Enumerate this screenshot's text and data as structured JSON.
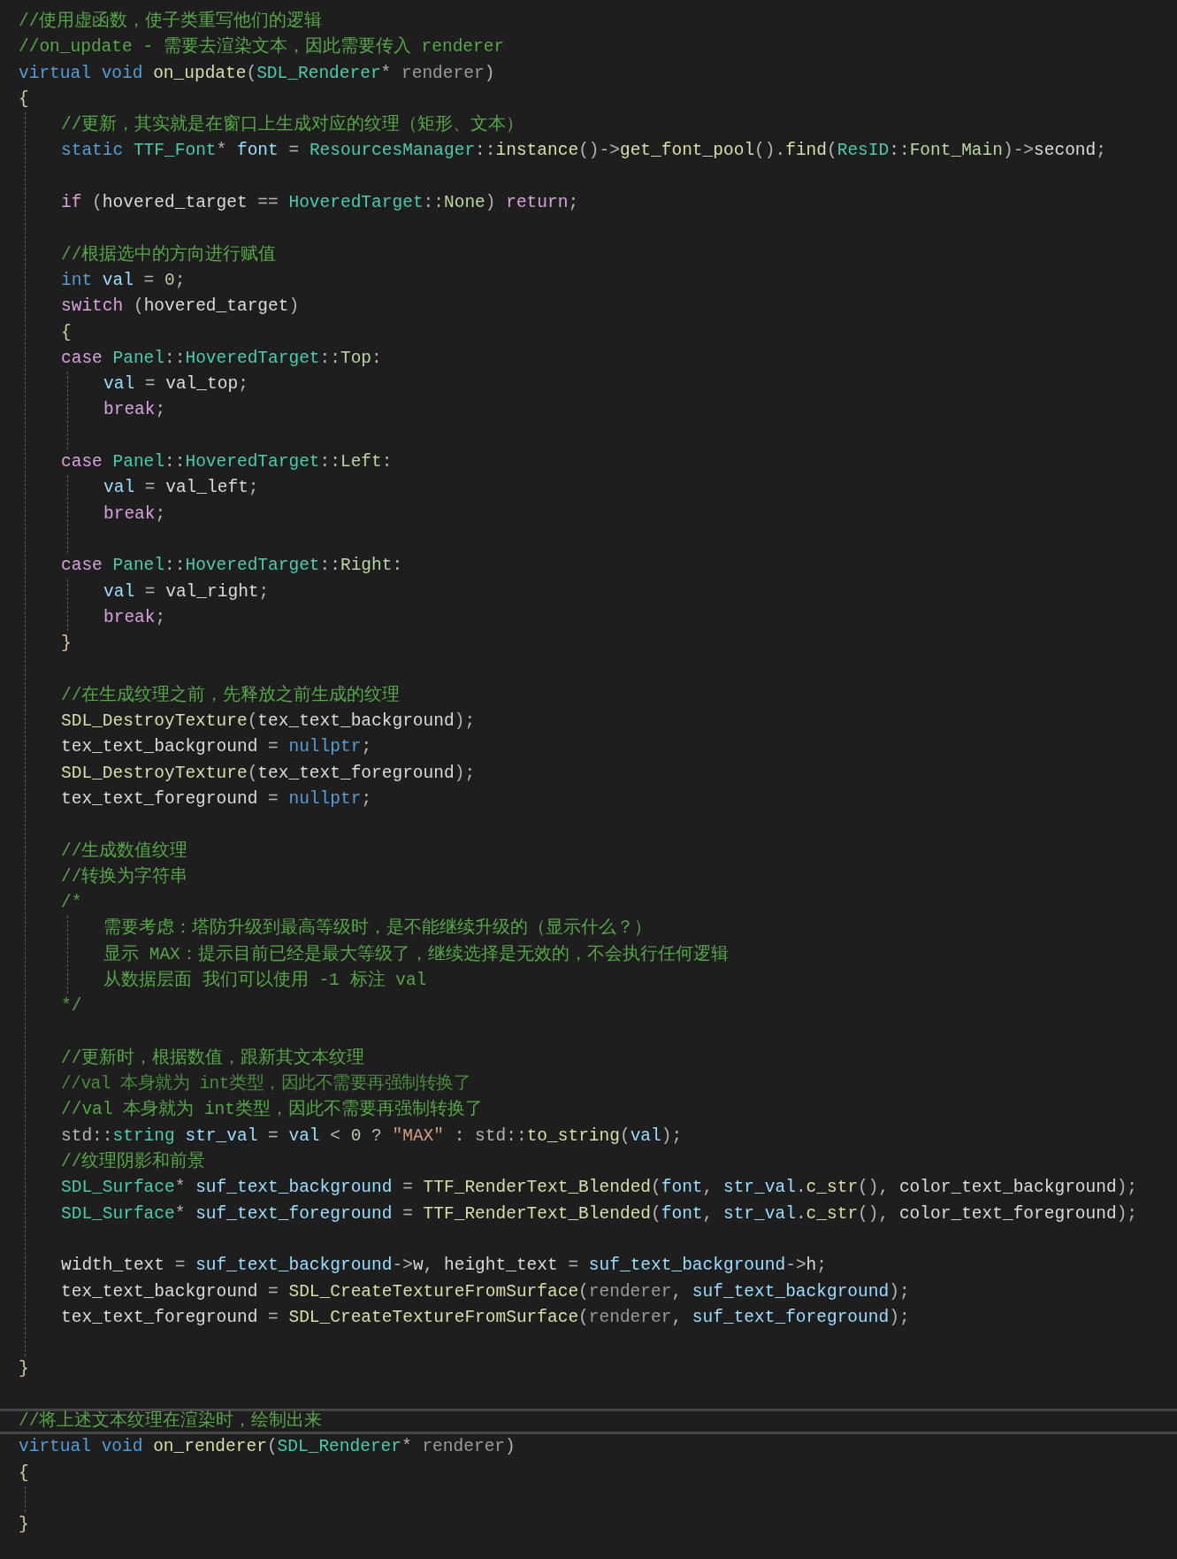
{
  "editor": {
    "lines": [
      {
        "kind": "code",
        "tokens": [
          {
            "text": "//使用虚函数，使子类重写他们的逻辑",
            "kind": "comment"
          }
        ]
      },
      {
        "kind": "code",
        "tokens": [
          {
            "text": "//on_update - 需要去渲染文本，因此需要传入 renderer",
            "kind": "comment"
          }
        ]
      },
      {
        "kind": "code",
        "tokens": [
          {
            "text": "virtual ",
            "kind": "keyword"
          },
          {
            "text": "void ",
            "kind": "keyword"
          },
          {
            "text": "on_update",
            "kind": "function"
          },
          {
            "text": "(",
            "kind": "punct"
          },
          {
            "text": "SDL_Renderer",
            "kind": "type"
          },
          {
            "text": "* ",
            "kind": "punct"
          },
          {
            "text": "renderer",
            "kind": "param"
          },
          {
            "text": ")",
            "kind": "punct"
          }
        ]
      },
      {
        "kind": "code",
        "tokens": [
          {
            "text": "{",
            "kind": "brace"
          }
        ],
        "children": [
          {
            "kind": "code",
            "tokens": [
              {
                "text": "//更新，其实就是在窗口上生成对应的纹理（矩形、文本）",
                "kind": "comment"
              }
            ]
          },
          {
            "kind": "code",
            "tokens": [
              {
                "text": "static ",
                "kind": "keyword"
              },
              {
                "text": "TTF_Font",
                "kind": "type"
              },
              {
                "text": "* ",
                "kind": "punct"
              },
              {
                "text": "font",
                "kind": "local"
              },
              {
                "text": " = ",
                "kind": "punct"
              },
              {
                "text": "ResourcesManager",
                "kind": "type"
              },
              {
                "text": "::",
                "kind": "punct"
              },
              {
                "text": "instance",
                "kind": "function"
              },
              {
                "text": "()->",
                "kind": "punct"
              },
              {
                "text": "get_font_pool",
                "kind": "function"
              },
              {
                "text": "().",
                "kind": "punct"
              },
              {
                "text": "find",
                "kind": "function"
              },
              {
                "text": "(",
                "kind": "punct"
              },
              {
                "text": "ResID",
                "kind": "type"
              },
              {
                "text": "::",
                "kind": "punct"
              },
              {
                "text": "Font_Main",
                "kind": "enum"
              },
              {
                "text": ")->",
                "kind": "punct"
              },
              {
                "text": "second",
                "kind": "member"
              },
              {
                "text": ";",
                "kind": "punct"
              }
            ]
          },
          {
            "kind": "blank"
          },
          {
            "kind": "code",
            "tokens": [
              {
                "text": "if",
                "kind": "control"
              },
              {
                "text": " (",
                "kind": "punct"
              },
              {
                "text": "hovered_target",
                "kind": "member"
              },
              {
                "text": " == ",
                "kind": "punct"
              },
              {
                "text": "HoveredTarget",
                "kind": "type"
              },
              {
                "text": "::",
                "kind": "punct"
              },
              {
                "text": "None",
                "kind": "enum"
              },
              {
                "text": ") ",
                "kind": "punct"
              },
              {
                "text": "return",
                "kind": "control"
              },
              {
                "text": ";",
                "kind": "punct"
              }
            ]
          },
          {
            "kind": "blank"
          },
          {
            "kind": "code",
            "tokens": [
              {
                "text": "//根据选中的方向进行赋值",
                "kind": "comment"
              }
            ]
          },
          {
            "kind": "code",
            "tokens": [
              {
                "text": "int ",
                "kind": "keyword"
              },
              {
                "text": "val",
                "kind": "local"
              },
              {
                "text": " = ",
                "kind": "punct"
              },
              {
                "text": "0",
                "kind": "number"
              },
              {
                "text": ";",
                "kind": "punct"
              }
            ]
          },
          {
            "kind": "code",
            "tokens": [
              {
                "text": "switch",
                "kind": "control"
              },
              {
                "text": " (",
                "kind": "punct"
              },
              {
                "text": "hovered_target",
                "kind": "member"
              },
              {
                "text": ")",
                "kind": "punct"
              }
            ]
          },
          {
            "kind": "code",
            "tokens": [
              {
                "text": "{",
                "kind": "brace"
              }
            ]
          },
          {
            "kind": "code",
            "tokens": [
              {
                "text": "case ",
                "kind": "control"
              },
              {
                "text": "Panel",
                "kind": "type"
              },
              {
                "text": "::",
                "kind": "punct"
              },
              {
                "text": "HoveredTarget",
                "kind": "type"
              },
              {
                "text": "::",
                "kind": "punct"
              },
              {
                "text": "Top",
                "kind": "enum"
              },
              {
                "text": ":",
                "kind": "punct"
              }
            ],
            "children": [
              {
                "kind": "code",
                "tokens": [
                  {
                    "text": "val",
                    "kind": "local"
                  },
                  {
                    "text": " = ",
                    "kind": "punct"
                  },
                  {
                    "text": "val_top",
                    "kind": "member"
                  },
                  {
                    "text": ";",
                    "kind": "punct"
                  }
                ]
              },
              {
                "kind": "code",
                "tokens": [
                  {
                    "text": "break",
                    "kind": "control"
                  },
                  {
                    "text": ";",
                    "kind": "punct"
                  }
                ]
              },
              {
                "kind": "blank"
              }
            ]
          },
          {
            "kind": "code",
            "tokens": [
              {
                "text": "case ",
                "kind": "control"
              },
              {
                "text": "Panel",
                "kind": "type"
              },
              {
                "text": "::",
                "kind": "punct"
              },
              {
                "text": "HoveredTarget",
                "kind": "type"
              },
              {
                "text": "::",
                "kind": "punct"
              },
              {
                "text": "Left",
                "kind": "enum"
              },
              {
                "text": ":",
                "kind": "punct"
              }
            ],
            "children": [
              {
                "kind": "code",
                "tokens": [
                  {
                    "text": "val",
                    "kind": "local"
                  },
                  {
                    "text": " = ",
                    "kind": "punct"
                  },
                  {
                    "text": "val_left",
                    "kind": "member"
                  },
                  {
                    "text": ";",
                    "kind": "punct"
                  }
                ]
              },
              {
                "kind": "code",
                "tokens": [
                  {
                    "text": "break",
                    "kind": "control"
                  },
                  {
                    "text": ";",
                    "kind": "punct"
                  }
                ]
              },
              {
                "kind": "blank"
              }
            ]
          },
          {
            "kind": "code",
            "tokens": [
              {
                "text": "case ",
                "kind": "control"
              },
              {
                "text": "Panel",
                "kind": "type"
              },
              {
                "text": "::",
                "kind": "punct"
              },
              {
                "text": "HoveredTarget",
                "kind": "type"
              },
              {
                "text": "::",
                "kind": "punct"
              },
              {
                "text": "Right",
                "kind": "enum"
              },
              {
                "text": ":",
                "kind": "punct"
              }
            ],
            "children": [
              {
                "kind": "code",
                "tokens": [
                  {
                    "text": "val",
                    "kind": "local"
                  },
                  {
                    "text": " = ",
                    "kind": "punct"
                  },
                  {
                    "text": "val_right",
                    "kind": "member"
                  },
                  {
                    "text": ";",
                    "kind": "punct"
                  }
                ]
              },
              {
                "kind": "code",
                "tokens": [
                  {
                    "text": "break",
                    "kind": "control"
                  },
                  {
                    "text": ";",
                    "kind": "punct"
                  }
                ]
              }
            ]
          },
          {
            "kind": "code",
            "tokens": [
              {
                "text": "}",
                "kind": "brace"
              }
            ]
          },
          {
            "kind": "blank"
          },
          {
            "kind": "code",
            "tokens": [
              {
                "text": "//在生成纹理之前，先释放之前生成的纹理",
                "kind": "comment"
              }
            ]
          },
          {
            "kind": "code",
            "tokens": [
              {
                "text": "SDL_DestroyTexture",
                "kind": "function"
              },
              {
                "text": "(",
                "kind": "punct"
              },
              {
                "text": "tex_text_background",
                "kind": "member"
              },
              {
                "text": ");",
                "kind": "punct"
              }
            ]
          },
          {
            "kind": "code",
            "tokens": [
              {
                "text": "tex_text_background",
                "kind": "member"
              },
              {
                "text": " = ",
                "kind": "punct"
              },
              {
                "text": "nullptr",
                "kind": "keyword"
              },
              {
                "text": ";",
                "kind": "punct"
              }
            ]
          },
          {
            "kind": "code",
            "tokens": [
              {
                "text": "SDL_DestroyTexture",
                "kind": "function"
              },
              {
                "text": "(",
                "kind": "punct"
              },
              {
                "text": "tex_text_foreground",
                "kind": "member"
              },
              {
                "text": ");",
                "kind": "punct"
              }
            ]
          },
          {
            "kind": "code",
            "tokens": [
              {
                "text": "tex_text_foreground",
                "kind": "member"
              },
              {
                "text": " = ",
                "kind": "punct"
              },
              {
                "text": "nullptr",
                "kind": "keyword"
              },
              {
                "text": ";",
                "kind": "punct"
              }
            ]
          },
          {
            "kind": "blank"
          },
          {
            "kind": "code",
            "tokens": [
              {
                "text": "//生成数值纹理",
                "kind": "comment"
              }
            ]
          },
          {
            "kind": "code",
            "tokens": [
              {
                "text": "//转换为字符串",
                "kind": "comment"
              }
            ]
          },
          {
            "kind": "code",
            "tokens": [
              {
                "text": "/*",
                "kind": "comment"
              }
            ],
            "children": [
              {
                "kind": "code",
                "tokens": [
                  {
                    "text": "需要考虑：塔防升级到最高等级时，是不能继续升级的（显示什么？）",
                    "kind": "comment"
                  }
                ]
              },
              {
                "kind": "code",
                "tokens": [
                  {
                    "text": "显示 MAX：提示目前已经是最大等级了，继续选择是无效的，不会执行任何逻辑",
                    "kind": "comment"
                  }
                ]
              },
              {
                "kind": "code",
                "tokens": [
                  {
                    "text": "从数据层面 我们可以使用 -1 标注 val",
                    "kind": "comment"
                  }
                ]
              }
            ]
          },
          {
            "kind": "code",
            "tokens": [
              {
                "text": "*/",
                "kind": "comment"
              }
            ]
          },
          {
            "kind": "blank"
          },
          {
            "kind": "code",
            "tokens": [
              {
                "text": "//更新时，根据数值，跟新其文本纹理",
                "kind": "comment"
              }
            ]
          },
          {
            "kind": "ghost",
            "tokens": [
              {
                "text": "//val 本身就为 int类型，因此不需要再强制转换了",
                "kind": "comment"
              }
            ]
          },
          {
            "kind": "code",
            "tokens": [
              {
                "text": "//val 本身就为 int类型，因此不需要再强制转换了",
                "kind": "comment"
              }
            ]
          },
          {
            "kind": "code",
            "tokens": [
              {
                "text": "std::",
                "kind": "punct"
              },
              {
                "text": "string ",
                "kind": "type"
              },
              {
                "text": "str_val",
                "kind": "local"
              },
              {
                "text": " = ",
                "kind": "punct"
              },
              {
                "text": "val",
                "kind": "local"
              },
              {
                "text": " < ",
                "kind": "punct"
              },
              {
                "text": "0",
                "kind": "number"
              },
              {
                "text": " ? ",
                "kind": "punct"
              },
              {
                "text": "\"MAX\"",
                "kind": "string"
              },
              {
                "text": " : std::",
                "kind": "punct"
              },
              {
                "text": "to_string",
                "kind": "function"
              },
              {
                "text": "(",
                "kind": "punct"
              },
              {
                "text": "val",
                "kind": "local"
              },
              {
                "text": ");",
                "kind": "punct"
              }
            ]
          },
          {
            "kind": "code",
            "tokens": [
              {
                "text": "//纹理阴影和前景",
                "kind": "comment"
              }
            ]
          },
          {
            "kind": "code",
            "tokens": [
              {
                "text": "SDL_Surface",
                "kind": "type"
              },
              {
                "text": "* ",
                "kind": "punct"
              },
              {
                "text": "suf_text_background",
                "kind": "local"
              },
              {
                "text": " = ",
                "kind": "punct"
              },
              {
                "text": "TTF_RenderText_Blended",
                "kind": "function"
              },
              {
                "text": "(",
                "kind": "punct"
              },
              {
                "text": "font",
                "kind": "local"
              },
              {
                "text": ", ",
                "kind": "punct"
              },
              {
                "text": "str_val",
                "kind": "local"
              },
              {
                "text": ".",
                "kind": "punct"
              },
              {
                "text": "c_str",
                "kind": "function"
              },
              {
                "text": "(), ",
                "kind": "punct"
              },
              {
                "text": "color_text_background",
                "kind": "member"
              },
              {
                "text": ");",
                "kind": "punct"
              }
            ]
          },
          {
            "kind": "code",
            "tokens": [
              {
                "text": "SDL_Surface",
                "kind": "type"
              },
              {
                "text": "* ",
                "kind": "punct"
              },
              {
                "text": "suf_text_foreground",
                "kind": "local"
              },
              {
                "text": " = ",
                "kind": "punct"
              },
              {
                "text": "TTF_RenderText_Blended",
                "kind": "function"
              },
              {
                "text": "(",
                "kind": "punct"
              },
              {
                "text": "font",
                "kind": "local"
              },
              {
                "text": ", ",
                "kind": "punct"
              },
              {
                "text": "str_val",
                "kind": "local"
              },
              {
                "text": ".",
                "kind": "punct"
              },
              {
                "text": "c_str",
                "kind": "function"
              },
              {
                "text": "(), ",
                "kind": "punct"
              },
              {
                "text": "color_text_foreground",
                "kind": "member"
              },
              {
                "text": ");",
                "kind": "punct"
              }
            ]
          },
          {
            "kind": "blank"
          },
          {
            "kind": "code",
            "tokens": [
              {
                "text": "width_text",
                "kind": "member"
              },
              {
                "text": " = ",
                "kind": "punct"
              },
              {
                "text": "suf_text_background",
                "kind": "local"
              },
              {
                "text": "->",
                "kind": "punct"
              },
              {
                "text": "w",
                "kind": "member"
              },
              {
                "text": ", ",
                "kind": "punct"
              },
              {
                "text": "height_text",
                "kind": "member"
              },
              {
                "text": " = ",
                "kind": "punct"
              },
              {
                "text": "suf_text_background",
                "kind": "local"
              },
              {
                "text": "->",
                "kind": "punct"
              },
              {
                "text": "h",
                "kind": "member"
              },
              {
                "text": ";",
                "kind": "punct"
              }
            ]
          },
          {
            "kind": "code",
            "tokens": [
              {
                "text": "tex_text_background",
                "kind": "member"
              },
              {
                "text": " = ",
                "kind": "punct"
              },
              {
                "text": "SDL_CreateTextureFromSurface",
                "kind": "function"
              },
              {
                "text": "(",
                "kind": "punct"
              },
              {
                "text": "renderer",
                "kind": "param"
              },
              {
                "text": ", ",
                "kind": "punct"
              },
              {
                "text": "suf_text_background",
                "kind": "local"
              },
              {
                "text": ");",
                "kind": "punct"
              }
            ]
          },
          {
            "kind": "code",
            "tokens": [
              {
                "text": "tex_text_foreground",
                "kind": "member"
              },
              {
                "text": " = ",
                "kind": "punct"
              },
              {
                "text": "SDL_CreateTextureFromSurface",
                "kind": "function"
              },
              {
                "text": "(",
                "kind": "punct"
              },
              {
                "text": "renderer",
                "kind": "param"
              },
              {
                "text": ", ",
                "kind": "punct"
              },
              {
                "text": "suf_text_foreground",
                "kind": "local"
              },
              {
                "text": ");",
                "kind": "punct"
              }
            ]
          },
          {
            "kind": "blank"
          }
        ]
      },
      {
        "kind": "code",
        "tokens": [
          {
            "text": "}",
            "kind": "brace"
          }
        ]
      },
      {
        "kind": "blank"
      },
      {
        "kind": "code",
        "current": true,
        "tokens": [
          {
            "text": "//将上述文本纹理在渲染时，绘制出来",
            "kind": "comment"
          }
        ]
      },
      {
        "kind": "code",
        "tokens": [
          {
            "text": "virtual ",
            "kind": "keyword"
          },
          {
            "text": "void ",
            "kind": "keyword"
          },
          {
            "text": "on_renderer",
            "kind": "function"
          },
          {
            "text": "(",
            "kind": "punct"
          },
          {
            "text": "SDL_Renderer",
            "kind": "type"
          },
          {
            "text": "* ",
            "kind": "punct"
          },
          {
            "text": "renderer",
            "kind": "param"
          },
          {
            "text": ")",
            "kind": "punct"
          }
        ]
      },
      {
        "kind": "code",
        "tokens": [
          {
            "text": "{",
            "kind": "brace"
          }
        ],
        "children": [
          {
            "kind": "blank"
          }
        ]
      },
      {
        "kind": "code",
        "tokens": [
          {
            "text": "}",
            "kind": "brace"
          }
        ]
      }
    ]
  }
}
